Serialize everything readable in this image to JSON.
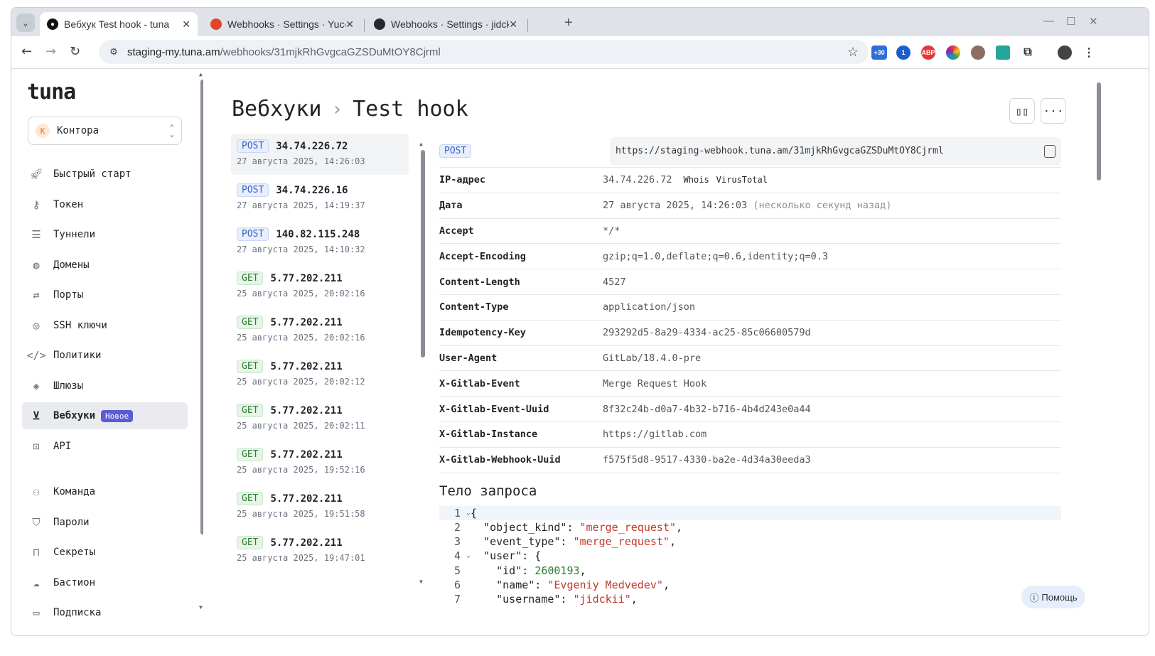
{
  "browser": {
    "tabs": [
      {
        "title": "Вебхук Test hook - tuna",
        "active": true
      },
      {
        "title": "Webhooks · Settings · Yucca",
        "active": false
      },
      {
        "title": "Webhooks · Settings · jidckii",
        "active": false
      }
    ],
    "url_host": "staging-my.tuna.am",
    "url_path": "/webhooks/31mjkRhGvgcaGZSDuMtOY8Cjrml",
    "ext_badge": "+30"
  },
  "sidebar": {
    "logo": "tuna",
    "org": {
      "initial": "К",
      "name": "Контора"
    },
    "items": [
      {
        "label": "Быстрый старт",
        "icon": "rocket-icon"
      },
      {
        "label": "Токен",
        "icon": "key-icon"
      },
      {
        "label": "Туннели",
        "icon": "server-icon"
      },
      {
        "label": "Домены",
        "icon": "globe-icon"
      },
      {
        "label": "Порты",
        "icon": "arrows-icon"
      },
      {
        "label": "SSH ключи",
        "icon": "fingerprint-icon"
      },
      {
        "label": "Политики",
        "icon": "code-icon"
      },
      {
        "label": "Шлюзы",
        "icon": "layers-icon"
      },
      {
        "label": "Вебхуки",
        "icon": "inbox-icon",
        "badge": "Новое",
        "active": true
      },
      {
        "label": "API",
        "icon": "terminal-icon"
      }
    ],
    "items2": [
      {
        "label": "Команда",
        "icon": "team-icon"
      },
      {
        "label": "Пароли",
        "icon": "shield-icon"
      },
      {
        "label": "Секреты",
        "icon": "lock-icon"
      },
      {
        "label": "Бастион",
        "icon": "cloud-icon"
      },
      {
        "label": "Подписка",
        "icon": "card-icon"
      }
    ]
  },
  "main": {
    "breadcrumb_root": "Вебхуки",
    "breadcrumb_current": "Test hook",
    "requests": [
      {
        "method": "POST",
        "ip": "34.74.226.72",
        "date": "27 августа 2025, 14:26:03",
        "active": true
      },
      {
        "method": "POST",
        "ip": "34.74.226.16",
        "date": "27 августа 2025, 14:19:37"
      },
      {
        "method": "POST",
        "ip": "140.82.115.248",
        "date": "27 августа 2025, 14:10:32"
      },
      {
        "method": "GET",
        "ip": "5.77.202.211",
        "date": "25 августа 2025, 20:02:16"
      },
      {
        "method": "GET",
        "ip": "5.77.202.211",
        "date": "25 августа 2025, 20:02:16"
      },
      {
        "method": "GET",
        "ip": "5.77.202.211",
        "date": "25 августа 2025, 20:02:12"
      },
      {
        "method": "GET",
        "ip": "5.77.202.211",
        "date": "25 августа 2025, 20:02:11"
      },
      {
        "method": "GET",
        "ip": "5.77.202.211",
        "date": "25 августа 2025, 19:52:16"
      },
      {
        "method": "GET",
        "ip": "5.77.202.211",
        "date": "25 августа 2025, 19:51:58"
      },
      {
        "method": "GET",
        "ip": "5.77.202.211",
        "date": "25 августа 2025, 19:47:01"
      }
    ],
    "detail": {
      "method": "POST",
      "url": "https://staging-webhook.tuna.am/31mjkRhGvgcaGZSDuMtOY8Cjrml",
      "ip_label": "IP-адрес",
      "ip": "34.74.226.72",
      "whois": "Whois",
      "virustotal": "VirusTotal",
      "date_label": "Дата",
      "date": "27 августа 2025, 14:26:03",
      "date_rel": "(несколько секунд назад)",
      "headers": [
        {
          "k": "Accept",
          "v": "*/*"
        },
        {
          "k": "Accept-Encoding",
          "v": "gzip;q=1.0,deflate;q=0.6,identity;q=0.3"
        },
        {
          "k": "Content-Length",
          "v": "4527"
        },
        {
          "k": "Content-Type",
          "v": "application/json"
        },
        {
          "k": "Idempotency-Key",
          "v": "293292d5-8a29-4334-ac25-85c06600579d"
        },
        {
          "k": "User-Agent",
          "v": "GitLab/18.4.0-pre"
        },
        {
          "k": "X-Gitlab-Event",
          "v": "Merge Request Hook"
        },
        {
          "k": "X-Gitlab-Event-Uuid",
          "v": "8f32c24b-d0a7-4b32-b716-4b4d243e0a44"
        },
        {
          "k": "X-Gitlab-Instance",
          "v": "https://gitlab.com"
        },
        {
          "k": "X-Gitlab-Webhook-Uuid",
          "v": "f575f5d8-9517-4330-ba2e-4d34a30eeda3"
        }
      ],
      "body_title": "Тело запроса",
      "body_lines": [
        {
          "n": "1",
          "fold": true,
          "parts": [
            [
              "p",
              "{"
            ]
          ]
        },
        {
          "n": "2",
          "parts": [
            [
              "p",
              "  \"object_kind\": "
            ],
            [
              "s",
              "\"merge_request\""
            ],
            [
              "p",
              ","
            ]
          ]
        },
        {
          "n": "3",
          "parts": [
            [
              "p",
              "  \"event_type\": "
            ],
            [
              "s",
              "\"merge_request\""
            ],
            [
              "p",
              ","
            ]
          ]
        },
        {
          "n": "4",
          "fold": true,
          "parts": [
            [
              "p",
              "  \"user\": {"
            ]
          ]
        },
        {
          "n": "5",
          "parts": [
            [
              "p",
              "    \"id\": "
            ],
            [
              "d",
              "2600193"
            ],
            [
              "p",
              ","
            ]
          ]
        },
        {
          "n": "6",
          "parts": [
            [
              "p",
              "    \"name\": "
            ],
            [
              "s",
              "\"Evgeniy Medvedev\""
            ],
            [
              "p",
              ","
            ]
          ]
        },
        {
          "n": "7",
          "parts": [
            [
              "p",
              "    \"username\": "
            ],
            [
              "s",
              "\"jidckii\""
            ],
            [
              "p",
              ","
            ]
          ]
        }
      ]
    },
    "help_label": "Помощь"
  }
}
